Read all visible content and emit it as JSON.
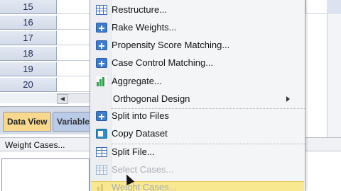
{
  "grid": {
    "rows": [
      "15",
      "16",
      "17",
      "18",
      "19",
      "20"
    ]
  },
  "tabs": {
    "data_view": "Data View",
    "variable_view": "Variable V"
  },
  "status": {
    "text": "Weight Cases..."
  },
  "menu": {
    "items": [
      {
        "label": "Restructure...",
        "icon": "restructure-icon",
        "enabled": true
      },
      {
        "label": "Rake Weights...",
        "icon": "plus-icon",
        "enabled": true
      },
      {
        "label": "Propensity Score Matching...",
        "icon": "plus-icon",
        "enabled": true
      },
      {
        "label": "Case Control Matching...",
        "icon": "plus-icon",
        "enabled": true
      },
      {
        "label": "Aggregate...",
        "icon": "aggregate-icon",
        "enabled": true
      },
      {
        "label": "Orthogonal Design",
        "icon": "",
        "enabled": true,
        "submenu": true
      },
      {
        "label": "Split into Files",
        "icon": "plus-icon",
        "enabled": true
      },
      {
        "label": "Copy Dataset",
        "icon": "copy-dataset-icon",
        "enabled": true
      },
      {
        "label": "Split File...",
        "icon": "split-file-icon",
        "enabled": true
      },
      {
        "label": "Select Cases...",
        "icon": "select-cases-icon",
        "enabled": false
      },
      {
        "label": "Weight Cases...",
        "icon": "weight-cases-icon",
        "enabled": false
      }
    ]
  },
  "colors": {
    "accent": "#3d7bd0",
    "active_tab": "#f7d88d",
    "highlight": "#f8e890"
  }
}
